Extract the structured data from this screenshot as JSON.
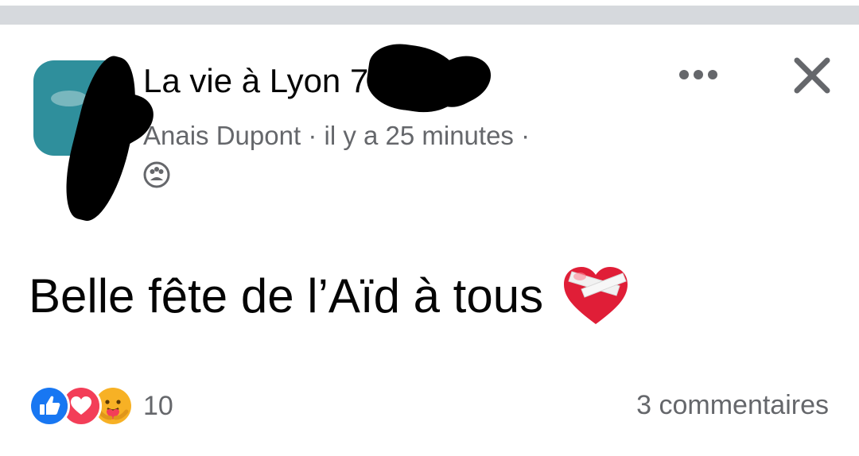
{
  "post": {
    "group_name": "La vie à Lyon 7",
    "author": "Anais Dupont",
    "time": "il y a 25 minutes",
    "privacy_icon": "group-privacy-icon",
    "text": "Belle fête de l’Aïd à tous",
    "text_emoji": "mending-heart-emoji"
  },
  "actions": {
    "more_icon": "more-dots-icon",
    "close_icon": "close-icon"
  },
  "footer": {
    "reactions": [
      "like-reaction-icon",
      "love-reaction-icon",
      "care-reaction-icon"
    ],
    "reaction_count": "10",
    "comments": "3 commentaires"
  },
  "colors": {
    "like": "#1877f2",
    "love": "#f33e58",
    "care": "#f7b125",
    "secondary_text": "#65676b",
    "avatar": "#2f8f9c"
  }
}
